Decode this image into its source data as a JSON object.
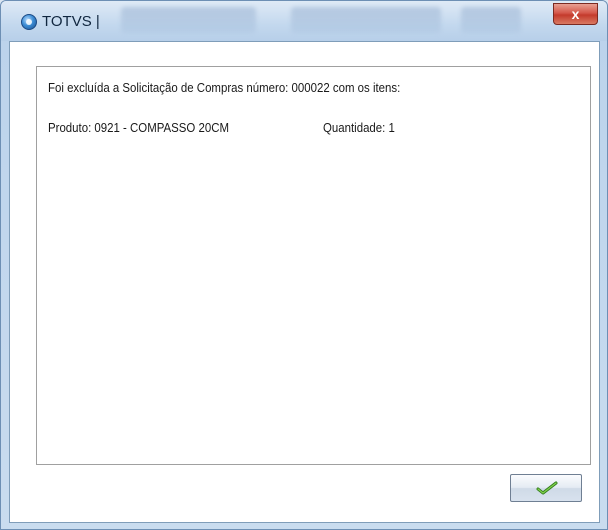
{
  "window": {
    "title": "TOTVS |",
    "close_label": "x"
  },
  "message": {
    "line1": "Foi excluída a Solicitação de Compras número: 000022 com os itens:",
    "product": "Produto: 0921 - COMPASSO 20CM",
    "quantity": "Quantidade: 1"
  },
  "buttons": {
    "ok_icon": "checkmark-icon"
  },
  "colors": {
    "titlebar": "#c3d8ee",
    "close": "#c43b2c",
    "checkmark": "#4a9a2a"
  }
}
